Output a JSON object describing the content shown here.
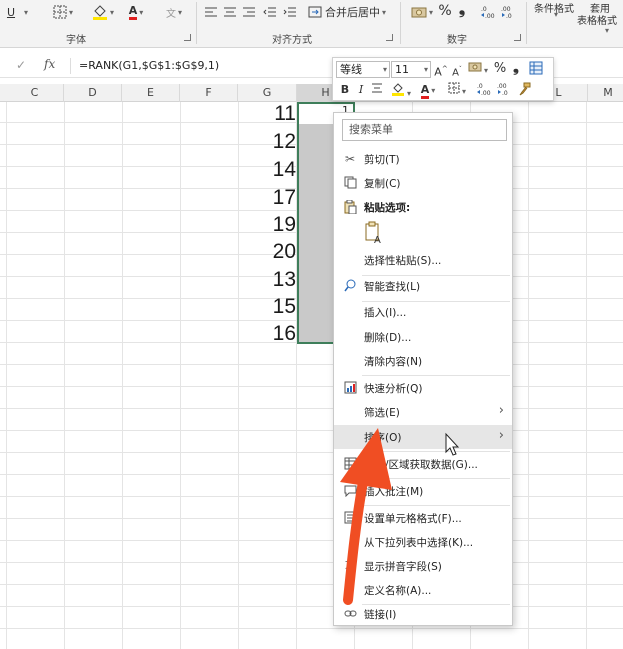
{
  "ribbon": {
    "groups": {
      "font": "字体",
      "align": "对齐方式",
      "number": "数字"
    },
    "merge_center": "合并后居中",
    "percent": "%",
    "comma": "❟",
    "cond_format": "条件格式",
    "apply_1": "套用",
    "apply_2": "表格格式"
  },
  "formula_bar": {
    "fx": "fx",
    "formula": "=RANK(G1,$G$1:$G$9,1)"
  },
  "columns": [
    "C",
    "D",
    "E",
    "F",
    "G",
    "H",
    "I",
    "L",
    "M"
  ],
  "cells": {
    "h1": "1",
    "g_values": [
      "11",
      "12",
      "14",
      "17",
      "19",
      "20",
      "13",
      "15",
      "16"
    ]
  },
  "mini_toolbar": {
    "font_name": "等线",
    "font_size": "11",
    "bold": "B",
    "italic": "I",
    "percent": "%",
    "comma": "❟"
  },
  "context_menu": {
    "search_placeholder": "搜索菜单",
    "items": {
      "cut": "剪切(T)",
      "copy": "复制(C)",
      "paste_options": "粘贴选项:",
      "paste_special": "选择性粘贴(S)...",
      "smart_lookup": "智能查找(L)",
      "insert": "插入(I)...",
      "delete": "删除(D)...",
      "clear": "清除内容(N)",
      "quick_analysis": "快速分析(Q)",
      "filter": "筛选(E)",
      "sort": "排序(O)",
      "get_data": "表格/区域获取数据(G)...",
      "comment": "插入批注(M)",
      "format_cells": "设置单元格格式(F)...",
      "pick_list": "从下拉列表中选择(K)...",
      "phonetic": "显示拼音字段(S)",
      "define_name": "定义名称(A)...",
      "link": "链接(I)"
    }
  },
  "colors": {
    "selection_border": "#3e7e5a",
    "arrow": "#f04e23",
    "highlight": "#e6e6e6"
  }
}
